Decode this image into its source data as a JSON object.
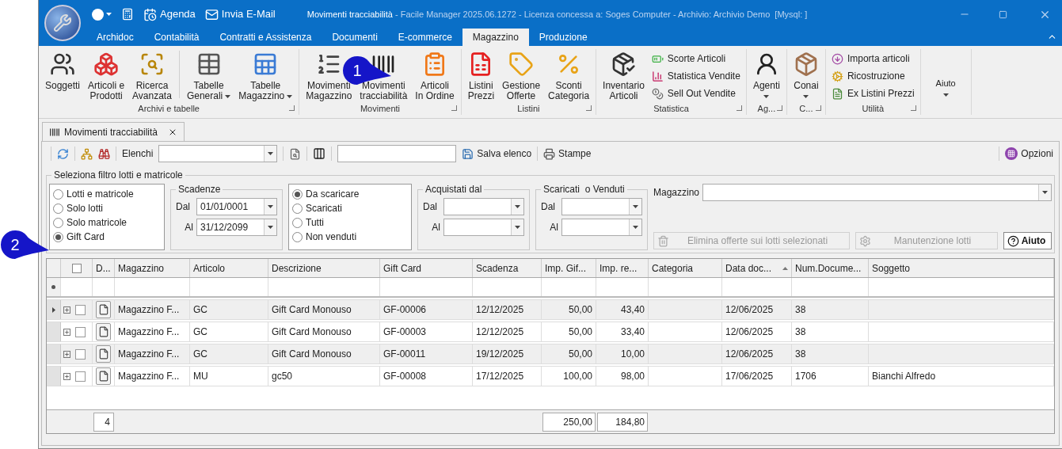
{
  "window": {
    "title": "Movimenti tracciabilità",
    "subtitle": "- Facile Manager 2025.06.1272 - Licenza concessa a: Soges Computer - Archivio: Archivio Demo  [Mysql: ]"
  },
  "quick_access": [
    "Agenda",
    "Invia E-Mail"
  ],
  "menu_tabs": [
    {
      "label": "Archidoc",
      "selected": false
    },
    {
      "label": "Contabilità",
      "selected": false
    },
    {
      "label": "Contratti e Assistenza",
      "selected": false
    },
    {
      "label": "Documenti",
      "selected": false
    },
    {
      "label": "E-commerce",
      "selected": false
    },
    {
      "label": "Magazzino",
      "selected": true
    },
    {
      "label": "Produzione",
      "selected": false
    }
  ],
  "ribbon_groups": [
    {
      "title": "Archivi e tabelle",
      "items": [
        {
          "kind": "large",
          "lines": [
            "Soggetti"
          ],
          "dropdown": false
        },
        {
          "kind": "large",
          "lines": [
            "Articoli e",
            "Prodotti"
          ],
          "dropdown": false
        },
        {
          "kind": "large",
          "lines": [
            "Ricerca",
            "Avanzata"
          ],
          "dropdown": false
        },
        {
          "kind": "separator"
        },
        {
          "kind": "large",
          "lines": [
            "Tabelle",
            "Generali"
          ],
          "dropdown": true
        },
        {
          "kind": "large",
          "lines": [
            "Tabelle",
            "Magazzino"
          ],
          "dropdown": true
        }
      ]
    },
    {
      "title": "Movimenti",
      "items": [
        {
          "kind": "large",
          "lines": [
            "Movimenti",
            "Magazzino"
          ],
          "dropdown": false
        },
        {
          "kind": "large",
          "lines": [
            "Movimenti",
            "tracciabilità"
          ],
          "dropdown": false
        },
        {
          "kind": "large",
          "lines": [
            "Articoli",
            "In Ordine"
          ],
          "dropdown": false
        }
      ]
    },
    {
      "title": "Listini",
      "items": [
        {
          "kind": "large",
          "lines": [
            "Listini",
            "Prezzi"
          ],
          "dropdown": false
        },
        {
          "kind": "large",
          "lines": [
            "Gestione",
            "Offerte"
          ],
          "dropdown": false
        },
        {
          "kind": "large",
          "lines": [
            "Sconti",
            "Categoria"
          ],
          "dropdown": false
        }
      ]
    },
    {
      "title": "Statistica",
      "items": [
        {
          "kind": "large",
          "lines": [
            "Inventario",
            "Articoli"
          ],
          "dropdown": false
        },
        {
          "kind": "small",
          "lines": [
            "Scorte Articoli"
          ],
          "dropdown": false
        },
        {
          "kind": "small",
          "lines": [
            "Statistica Vendite"
          ],
          "dropdown": false
        },
        {
          "kind": "small",
          "lines": [
            "Sell Out Vendite"
          ],
          "dropdown": false
        }
      ]
    },
    {
      "title": "Ag...",
      "items": [
        {
          "kind": "large",
          "lines": [
            "Agenti"
          ],
          "dropdown": true
        }
      ]
    },
    {
      "title": "C...",
      "items": [
        {
          "kind": "large",
          "lines": [
            "Conai"
          ],
          "dropdown": true
        }
      ]
    },
    {
      "title": "Utilità",
      "items": [
        {
          "kind": "small",
          "lines": [
            "Importa articoli"
          ],
          "dropdown": false
        },
        {
          "kind": "small",
          "lines": [
            "Ricostruzione"
          ],
          "dropdown": false
        },
        {
          "kind": "small",
          "lines": [
            "Ex Listini Prezzi"
          ],
          "dropdown": false
        }
      ]
    },
    {
      "items": [
        {
          "kind": "text",
          "lines": [
            "Aiuto"
          ],
          "dropdown": true
        }
      ]
    }
  ],
  "callouts": [
    {
      "label": "1"
    },
    {
      "label": "2"
    }
  ],
  "document_tabs": [
    {
      "label": "Movimenti tracciabilità",
      "selected": true
    }
  ],
  "toolbar": {
    "list_label": "Elenchi",
    "save": "Salva elenco",
    "print": "Stampe",
    "options": "Opzioni"
  },
  "filter": {
    "title": "Seleziona filtro lotti e matricole",
    "type_options": [
      {
        "label": "Lotti e matricole",
        "selected": false
      },
      {
        "label": "Solo lotti",
        "selected": false
      },
      {
        "label": "Solo matricole",
        "selected": false
      },
      {
        "label": "Gift Card",
        "selected": true
      }
    ],
    "scadenze": {
      "title": "Scadenze",
      "from_label": "Dal",
      "from": "01/01/0001",
      "to_label": "Al",
      "to": "31/12/2099"
    },
    "status_options": [
      {
        "label": "Da scaricare",
        "selected": true
      },
      {
        "label": "Scaricati",
        "selected": false
      },
      {
        "label": "Tutti",
        "selected": false
      },
      {
        "label": "Non venduti",
        "selected": false
      }
    ],
    "acquistati": {
      "title": "Acquistati dal",
      "from_label": "Dal",
      "to_label": "Al"
    },
    "scaricati": {
      "title": "Scaricati  o Venduti",
      "from_label": "Dal",
      "to_label": "Al"
    },
    "magazzino_label": "Magazzino",
    "buttons": [
      {
        "kind": "delete",
        "label": "Elimina offerte sui lotti selezionati",
        "disabled": true
      },
      {
        "kind": "maintenance",
        "label": "Manutenzione lotti",
        "disabled": true
      },
      {
        "kind": "help",
        "label": "Aiuto",
        "disabled": false
      }
    ]
  },
  "table": {
    "all_checked": false,
    "columns": [
      {
        "label": "D...",
        "sorted": false
      },
      {
        "label": "Magazzino",
        "sorted": false
      },
      {
        "label": "Articolo",
        "sorted": false
      },
      {
        "label": "Descrizione",
        "sorted": false
      },
      {
        "label": "Gift Card",
        "sorted": false
      },
      {
        "label": "Scadenza",
        "sorted": false
      },
      {
        "label": "Imp. Gif...",
        "sorted": false
      },
      {
        "label": "Imp. re...",
        "sorted": false
      },
      {
        "label": "Categoria",
        "sorted": false
      },
      {
        "label": "Data doc...",
        "sorted": true
      },
      {
        "label": "Num.Docume...",
        "sorted": false
      },
      {
        "label": "Soggetto",
        "sorted": false
      }
    ],
    "rows": [
      {
        "current": true,
        "checked": false,
        "cells": [
          "",
          "Magazzino F...",
          "GC",
          "Gift Card Monouso",
          "GF-00006",
          "12/12/2025",
          "50,00",
          "43,40",
          "",
          "12/06/2025",
          "38",
          ""
        ]
      },
      {
        "current": false,
        "checked": false,
        "cells": [
          "",
          "Magazzino F...",
          "GC",
          "Gift Card Monouso",
          "GF-00003",
          "12/12/2025",
          "50,00",
          "33,40",
          "",
          "12/06/2025",
          "38",
          ""
        ]
      },
      {
        "current": false,
        "checked": false,
        "cells": [
          "",
          "Magazzino F...",
          "GC",
          "Gift Card Monouso",
          "GF-00011",
          "19/12/2025",
          "50,00",
          "10,00",
          "",
          "12/06/2025",
          "38",
          ""
        ]
      },
      {
        "current": false,
        "checked": false,
        "cells": [
          "",
          "Magazzino F...",
          "MU",
          "gc50",
          "GF-00008",
          "17/12/2025",
          "100,00",
          "98,00",
          "",
          "17/06/2025",
          "1706",
          "Bianchi Alfredo"
        ]
      }
    ],
    "footer": {
      "count": "4",
      "total_gift": "250,00",
      "total_residual": "184,80"
    }
  }
}
